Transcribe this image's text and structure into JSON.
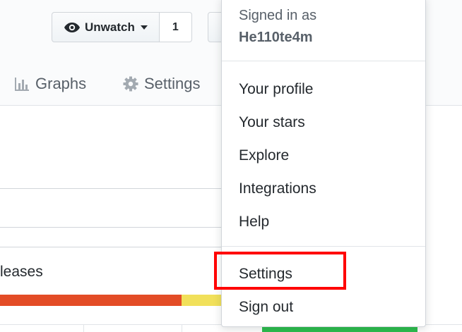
{
  "repo_header": {
    "unwatch_label": "Unwatch",
    "watch_count": "1"
  },
  "nav_tabs": [
    {
      "label": "Graphs",
      "icon": "graph-icon"
    },
    {
      "label": "Settings",
      "icon": "gear-icon"
    }
  ],
  "summary": {
    "releases_label": "leases"
  },
  "language_bar": {
    "colors": [
      "#e34c26",
      "#f1e05a"
    ]
  },
  "user_menu": {
    "signed_in_as": "Signed in as",
    "username": "He110te4m",
    "items": [
      "Your profile",
      "Your stars",
      "Explore",
      "Integrations",
      "Help",
      "Settings",
      "Sign out"
    ]
  },
  "annotation": {
    "highlight_color": "#ff0000",
    "highlight_target": "Settings"
  }
}
